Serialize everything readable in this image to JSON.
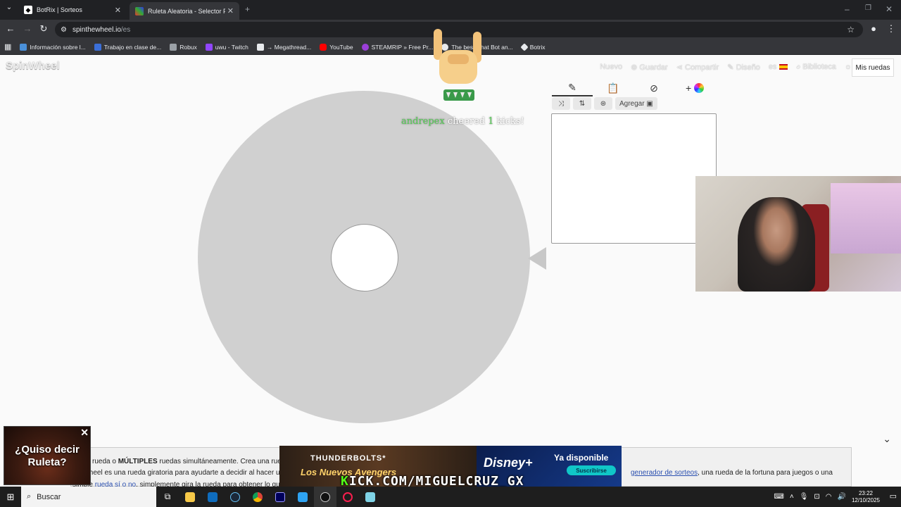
{
  "browser": {
    "tabs": [
      {
        "title": "BotRix | Sorteos",
        "active": false
      },
      {
        "title": "Ruleta Aleatoria - Selector Perso",
        "active": true
      }
    ],
    "url_host": "spinthewheel.io",
    "url_path": "/es",
    "bookmarks": [
      {
        "label": "Información sobre l...",
        "color": "#4a90d9"
      },
      {
        "label": "Trabajo en clase de...",
        "color": "#3b6fd8"
      },
      {
        "label": "Robux",
        "color": "#9aa0a6"
      },
      {
        "label": "uwu - Twitch",
        "color": "#9146ff"
      },
      {
        "label": "→ Megathread...",
        "color": "#e8eaed"
      },
      {
        "label": "YouTube",
        "color": "#ff0000"
      },
      {
        "label": "STEAMRIP » Free Pr...",
        "color": "#9b3fd9"
      },
      {
        "label": "The best Chat Bot an...",
        "color": "#e8eaed"
      },
      {
        "label": "Botrix",
        "color": "#e8eaed"
      }
    ]
  },
  "site": {
    "logo": "SpinWheel",
    "nav": [
      "Nuevo",
      "Guardar",
      "Compartir",
      "Diseño",
      "es",
      "Biblioteca"
    ],
    "my_wheels": "Mis ruedas",
    "tools": {
      "add_label": "Agregar"
    }
  },
  "overlay": {
    "cheer_user": "andrepex",
    "cheer_mid": "cheered",
    "cheer_num": "1",
    "cheer_end": "kicks!",
    "quiso": "¿Quiso decir Ruleta?",
    "banner_title": "THUNDERBOLTS*",
    "banner_sub": "Los Nuevos Avengers",
    "banner_brand": "Disney+",
    "banner_available": "Ya disponible",
    "banner_subscribe": "Suscribirse",
    "kick_url_k": "K",
    "kick_url": "ICK.COM/MIGUELCRUZ_GX"
  },
  "info": {
    "line1_a": "rueda o ",
    "line1_b": "MÚLTIPLES",
    "line1_c": " ruedas simultáneamente. Crea una rueda pe",
    "line2_a": "e Wheel es una rueda giratoria para ayudarte a decidir al hacer u",
    "line2_link": "generador de sorteos",
    "line2_b": ", una rueda de la fortuna para juegos o una",
    "line3_a": "simple ",
    "line3_link": "rueda sí o no",
    "line3_b": ", simplemente gira la rueda para obtener lo que nec"
  },
  "taskbar": {
    "search_placeholder": "Buscar",
    "time": "23:22",
    "date": "12/10/2025"
  }
}
